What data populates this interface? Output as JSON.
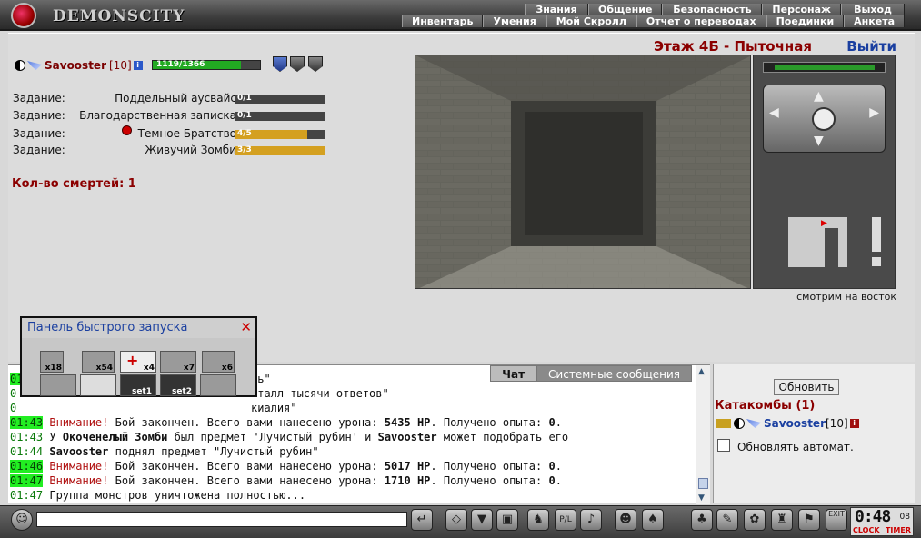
{
  "header": {
    "logo_text": "DEMONSCITY",
    "menu_top": [
      "Знания",
      "Общение",
      "Безопасность",
      "Персонаж",
      "Выход"
    ],
    "menu_bottom": [
      "Инвентарь",
      "Умения",
      "Мой Скролл",
      "Отчет о переводах",
      "Поединки",
      "Анкета"
    ]
  },
  "location": {
    "title": "Этаж 4Б - Пыточная",
    "exit_label": "Выйти",
    "facing": "смотрим на восток"
  },
  "character": {
    "name": "Savooster",
    "level": "[10]",
    "hp_text": "1119/1366",
    "hp_fraction": 0.82
  },
  "tasks": [
    {
      "label": "Задание:",
      "name": "Поддельный аусвайс",
      "progress": "0/1",
      "fraction": 0
    },
    {
      "label": "Задание:",
      "name": "Благодарственная записка",
      "progress": "0/1",
      "fraction": 0
    },
    {
      "label": "Задание:",
      "name": "Темное Братство",
      "progress": "4/5",
      "fraction": 0.8
    },
    {
      "label": "Задание:",
      "name": "Живучий Зомби",
      "progress": "3/3",
      "fraction": 1
    }
  ],
  "deaths": "Кол-во смертей: 1",
  "quick_panel": {
    "title": "Панель быстрого запуска",
    "slots": [
      {
        "count": "x18",
        "icon": "potion-icon"
      },
      {
        "count": "x54",
        "icon": "herb-icon"
      },
      {
        "count": "x4",
        "icon": "medkit-icon"
      },
      {
        "count": "x7",
        "icon": "scroll-icon"
      },
      {
        "count": "x6",
        "icon": "flask-icon"
      },
      {
        "count": "",
        "icon": "shield-icon"
      },
      {
        "count": "",
        "icon": "helmet-icon"
      },
      {
        "count": "set1",
        "icon": "set-icon"
      },
      {
        "count": "set2",
        "icon": "set-icon"
      },
      {
        "count": "",
        "icon": "ring-icon"
      }
    ]
  },
  "chat": {
    "tab_chat": "Чат",
    "tab_system": "Системные сообщения",
    "lines": [
      {
        "time": "01:",
        "text": "ль\"",
        "hl": true
      },
      {
        "time": "0",
        "text": "сталл тысячи ответов\"",
        "hl": false
      },
      {
        "time": "0",
        "text": "киалия\"",
        "hl": false
      },
      {
        "time": "01:43",
        "hl": true,
        "warn": "Внимание!",
        "pre": " Бой закончен. Всего вами нанесено урона: ",
        "b1": "5435 HP",
        "mid": ". Получено опыта: ",
        "b2": "0",
        "post": "."
      },
      {
        "time": "01:43",
        "hl": false,
        "pre": " У ",
        "b1": "Окоченелый Зомби",
        "mid": " был предмет 'Лучистый рубин' и ",
        "b2": "Savooster",
        "post": " может подобрать его"
      },
      {
        "time": "01:44",
        "hl": false,
        "pre": " ",
        "b1": "Savooster",
        "mid": " поднял предмет \"Лучистый рубин\"",
        "b2": "",
        "post": ""
      },
      {
        "time": "01:46",
        "hl": true,
        "warn": "Внимание!",
        "pre": " Бой закончен. Всего вами нанесено урона: ",
        "b1": "5017 HP",
        "mid": ". Получено опыта: ",
        "b2": "0",
        "post": "."
      },
      {
        "time": "01:47",
        "hl": true,
        "warn": "Внимание!",
        "pre": " Бой закончен. Всего вами нанесено урона: ",
        "b1": "1710 HP",
        "mid": ". Получено опыта: ",
        "b2": "0",
        "post": "."
      },
      {
        "time": "01:47",
        "hl": false,
        "pre": " Группа монстров уничтожена полностью...",
        "b1": "",
        "mid": "",
        "b2": "",
        "post": ""
      }
    ]
  },
  "room": {
    "refresh_label": "Обновить",
    "title": "Катакомбы (1)",
    "user_name": "Savooster",
    "user_level": "[10]",
    "auto_label": "Обновлять автомат."
  },
  "clock": {
    "time": "0:48",
    "seconds": "08",
    "label_clock": "CLOCK",
    "label_timer": "TIMER"
  },
  "colors": {
    "accent_red": "#8b0000",
    "link_blue": "#1a3fa0",
    "hp_green": "#22aa22",
    "task_gold": "#d4a020",
    "timestamp_highlight": "#22ee22"
  }
}
